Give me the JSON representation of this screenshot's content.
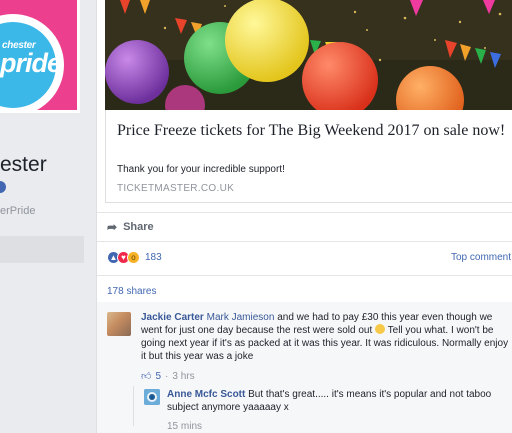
{
  "profile": {
    "logo_top_text": "chester",
    "logo_main_text": "pride",
    "page_name_fragment": "ester",
    "handle_fragment": "erPride"
  },
  "post": {
    "link": {
      "title": "Price Freeze tickets for The Big Weekend 2017 on sale now!",
      "description": "Thank you for your incredible support!",
      "domain": "TICKETMASTER.CO.UK"
    },
    "share_label": "Share",
    "reaction_count": "183",
    "top_comments_label": "Top comment",
    "shares_label": "178 shares"
  },
  "comments": [
    {
      "author": "Jackie Carter",
      "mention": "Mark Jamieson",
      "text_a": " and we had to pay £30 this year even though we went for just one day because the rest were sold out ",
      "text_b": " Tell you what. I won't be going next year if it's as packed at it was this year. It was ridiculous. Normally enjoy it but this year was a joke",
      "likes": "5",
      "time": "3 hrs"
    },
    {
      "author": "Anne Mcfc Scott",
      "text": " But that's great..... it's means it's popular and not taboo subject anymore yaaaaay x",
      "time": "15 mins"
    }
  ],
  "colors": {
    "brand_pink": "#ec3f8e",
    "logo_blue": "#3bb7e8",
    "link_blue": "#4267b2",
    "author_blue": "#385898"
  }
}
